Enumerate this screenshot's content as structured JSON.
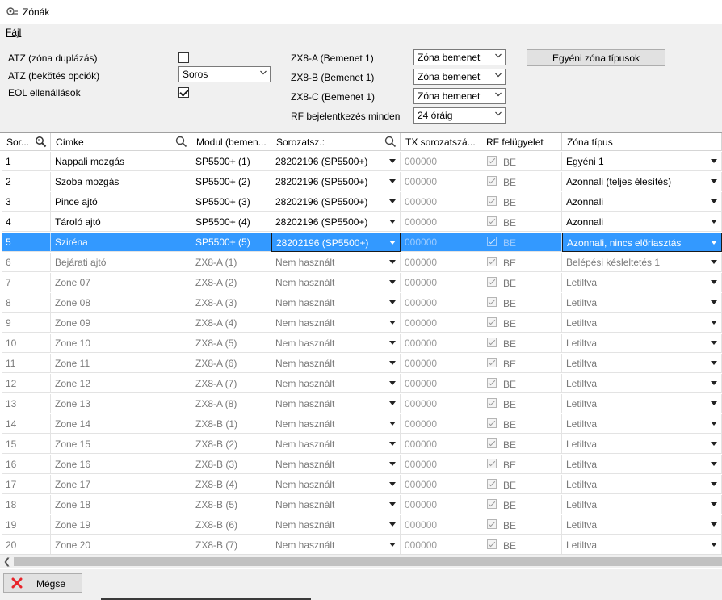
{
  "window": {
    "title": "Zónák"
  },
  "menu": {
    "file_label": "Fájl"
  },
  "options": {
    "atz_duplication_label": "ATZ (zóna duplázás)",
    "atz_wiring_label": "ATZ (bekötés opciók)",
    "atz_wiring_value": "Soros",
    "eol_label": "EOL ellenállások",
    "zx8a_label": "ZX8-A (Bemenet 1)",
    "zx8a_value": "Zóna bemenet",
    "zx8b_label": "ZX8-B (Bemenet 1)",
    "zx8b_value": "Zóna bemenet",
    "zx8c_label": "ZX8-C (Bemenet 1)",
    "zx8c_value": "Zóna bemenet",
    "rf_label": "RF bejelentkezés minden",
    "rf_value": "24 óráig",
    "custom_types_button": "Egyéni zóna típusok"
  },
  "table": {
    "headers": [
      "Sor...",
      "Címke",
      "Modul (bemen...",
      "Sorozatsz.:",
      "TX sorozatszá...",
      "RF felügyelet",
      "Zóna típus"
    ],
    "rows": [
      {
        "num": "1",
        "label": "Nappali mozgás",
        "module": "SP5500+  (1)",
        "serial": "28202196 (SP5500+)",
        "tx": "000000",
        "rf": "BE",
        "type": "Egyéni 1",
        "active": true
      },
      {
        "num": "2",
        "label": "Szoba mozgás",
        "module": "SP5500+  (2)",
        "serial": "28202196 (SP5500+)",
        "tx": "000000",
        "rf": "BE",
        "type": "Azonnali (teljes élesítés)",
        "active": true
      },
      {
        "num": "3",
        "label": "Pince ajtó",
        "module": "SP5500+  (3)",
        "serial": "28202196 (SP5500+)",
        "tx": "000000",
        "rf": "BE",
        "type": "Azonnali",
        "active": true
      },
      {
        "num": "4",
        "label": "Tároló ajtó",
        "module": "SP5500+  (4)",
        "serial": "28202196 (SP5500+)",
        "tx": "000000",
        "rf": "BE",
        "type": "Azonnali",
        "active": true
      },
      {
        "num": "5",
        "label": "Sziréna",
        "module": "SP5500+  (5)",
        "serial": "28202196 (SP5500+)",
        "tx": "000000",
        "rf": "BE",
        "type": "Azonnali, nincs előriasztás",
        "active": true,
        "selected": true
      },
      {
        "num": "6",
        "label": "Bejárati ajtó",
        "module": "ZX8-A (1)",
        "serial": "Nem használt",
        "tx": "000000",
        "rf": "BE",
        "type": "Belépési késleltetés 1",
        "active": false
      },
      {
        "num": "7",
        "label": "Zone 07",
        "module": "ZX8-A (2)",
        "serial": "Nem használt",
        "tx": "000000",
        "rf": "BE",
        "type": "Letiltva",
        "active": false
      },
      {
        "num": "8",
        "label": "Zone 08",
        "module": "ZX8-A (3)",
        "serial": "Nem használt",
        "tx": "000000",
        "rf": "BE",
        "type": "Letiltva",
        "active": false
      },
      {
        "num": "9",
        "label": "Zone 09",
        "module": "ZX8-A (4)",
        "serial": "Nem használt",
        "tx": "000000",
        "rf": "BE",
        "type": "Letiltva",
        "active": false
      },
      {
        "num": "10",
        "label": "Zone 10",
        "module": "ZX8-A (5)",
        "serial": "Nem használt",
        "tx": "000000",
        "rf": "BE",
        "type": "Letiltva",
        "active": false
      },
      {
        "num": "11",
        "label": "Zone 11",
        "module": "ZX8-A (6)",
        "serial": "Nem használt",
        "tx": "000000",
        "rf": "BE",
        "type": "Letiltva",
        "active": false
      },
      {
        "num": "12",
        "label": "Zone 12",
        "module": "ZX8-A (7)",
        "serial": "Nem használt",
        "tx": "000000",
        "rf": "BE",
        "type": "Letiltva",
        "active": false
      },
      {
        "num": "13",
        "label": "Zone 13",
        "module": "ZX8-A (8)",
        "serial": "Nem használt",
        "tx": "000000",
        "rf": "BE",
        "type": "Letiltva",
        "active": false
      },
      {
        "num": "14",
        "label": "Zone 14",
        "module": "ZX8-B (1)",
        "serial": "Nem használt",
        "tx": "000000",
        "rf": "BE",
        "type": "Letiltva",
        "active": false
      },
      {
        "num": "15",
        "label": "Zone 15",
        "module": "ZX8-B (2)",
        "serial": "Nem használt",
        "tx": "000000",
        "rf": "BE",
        "type": "Letiltva",
        "active": false
      },
      {
        "num": "16",
        "label": "Zone 16",
        "module": "ZX8-B (3)",
        "serial": "Nem használt",
        "tx": "000000",
        "rf": "BE",
        "type": "Letiltva",
        "active": false
      },
      {
        "num": "17",
        "label": "Zone 17",
        "module": "ZX8-B (4)",
        "serial": "Nem használt",
        "tx": "000000",
        "rf": "BE",
        "type": "Letiltva",
        "active": false
      },
      {
        "num": "18",
        "label": "Zone 18",
        "module": "ZX8-B (5)",
        "serial": "Nem használt",
        "tx": "000000",
        "rf": "BE",
        "type": "Letiltva",
        "active": false
      },
      {
        "num": "19",
        "label": "Zone 19",
        "module": "ZX8-B (6)",
        "serial": "Nem használt",
        "tx": "000000",
        "rf": "BE",
        "type": "Letiltva",
        "active": false
      },
      {
        "num": "20",
        "label": "Zone 20",
        "module": "ZX8-B (7)",
        "serial": "Nem használt",
        "tx": "000000",
        "rf": "BE",
        "type": "Letiltva",
        "active": false
      }
    ]
  },
  "footer": {
    "cancel_label": "Mégse"
  },
  "colors": {
    "selection": "#3399ff",
    "cancel_icon": "#e8252b"
  }
}
